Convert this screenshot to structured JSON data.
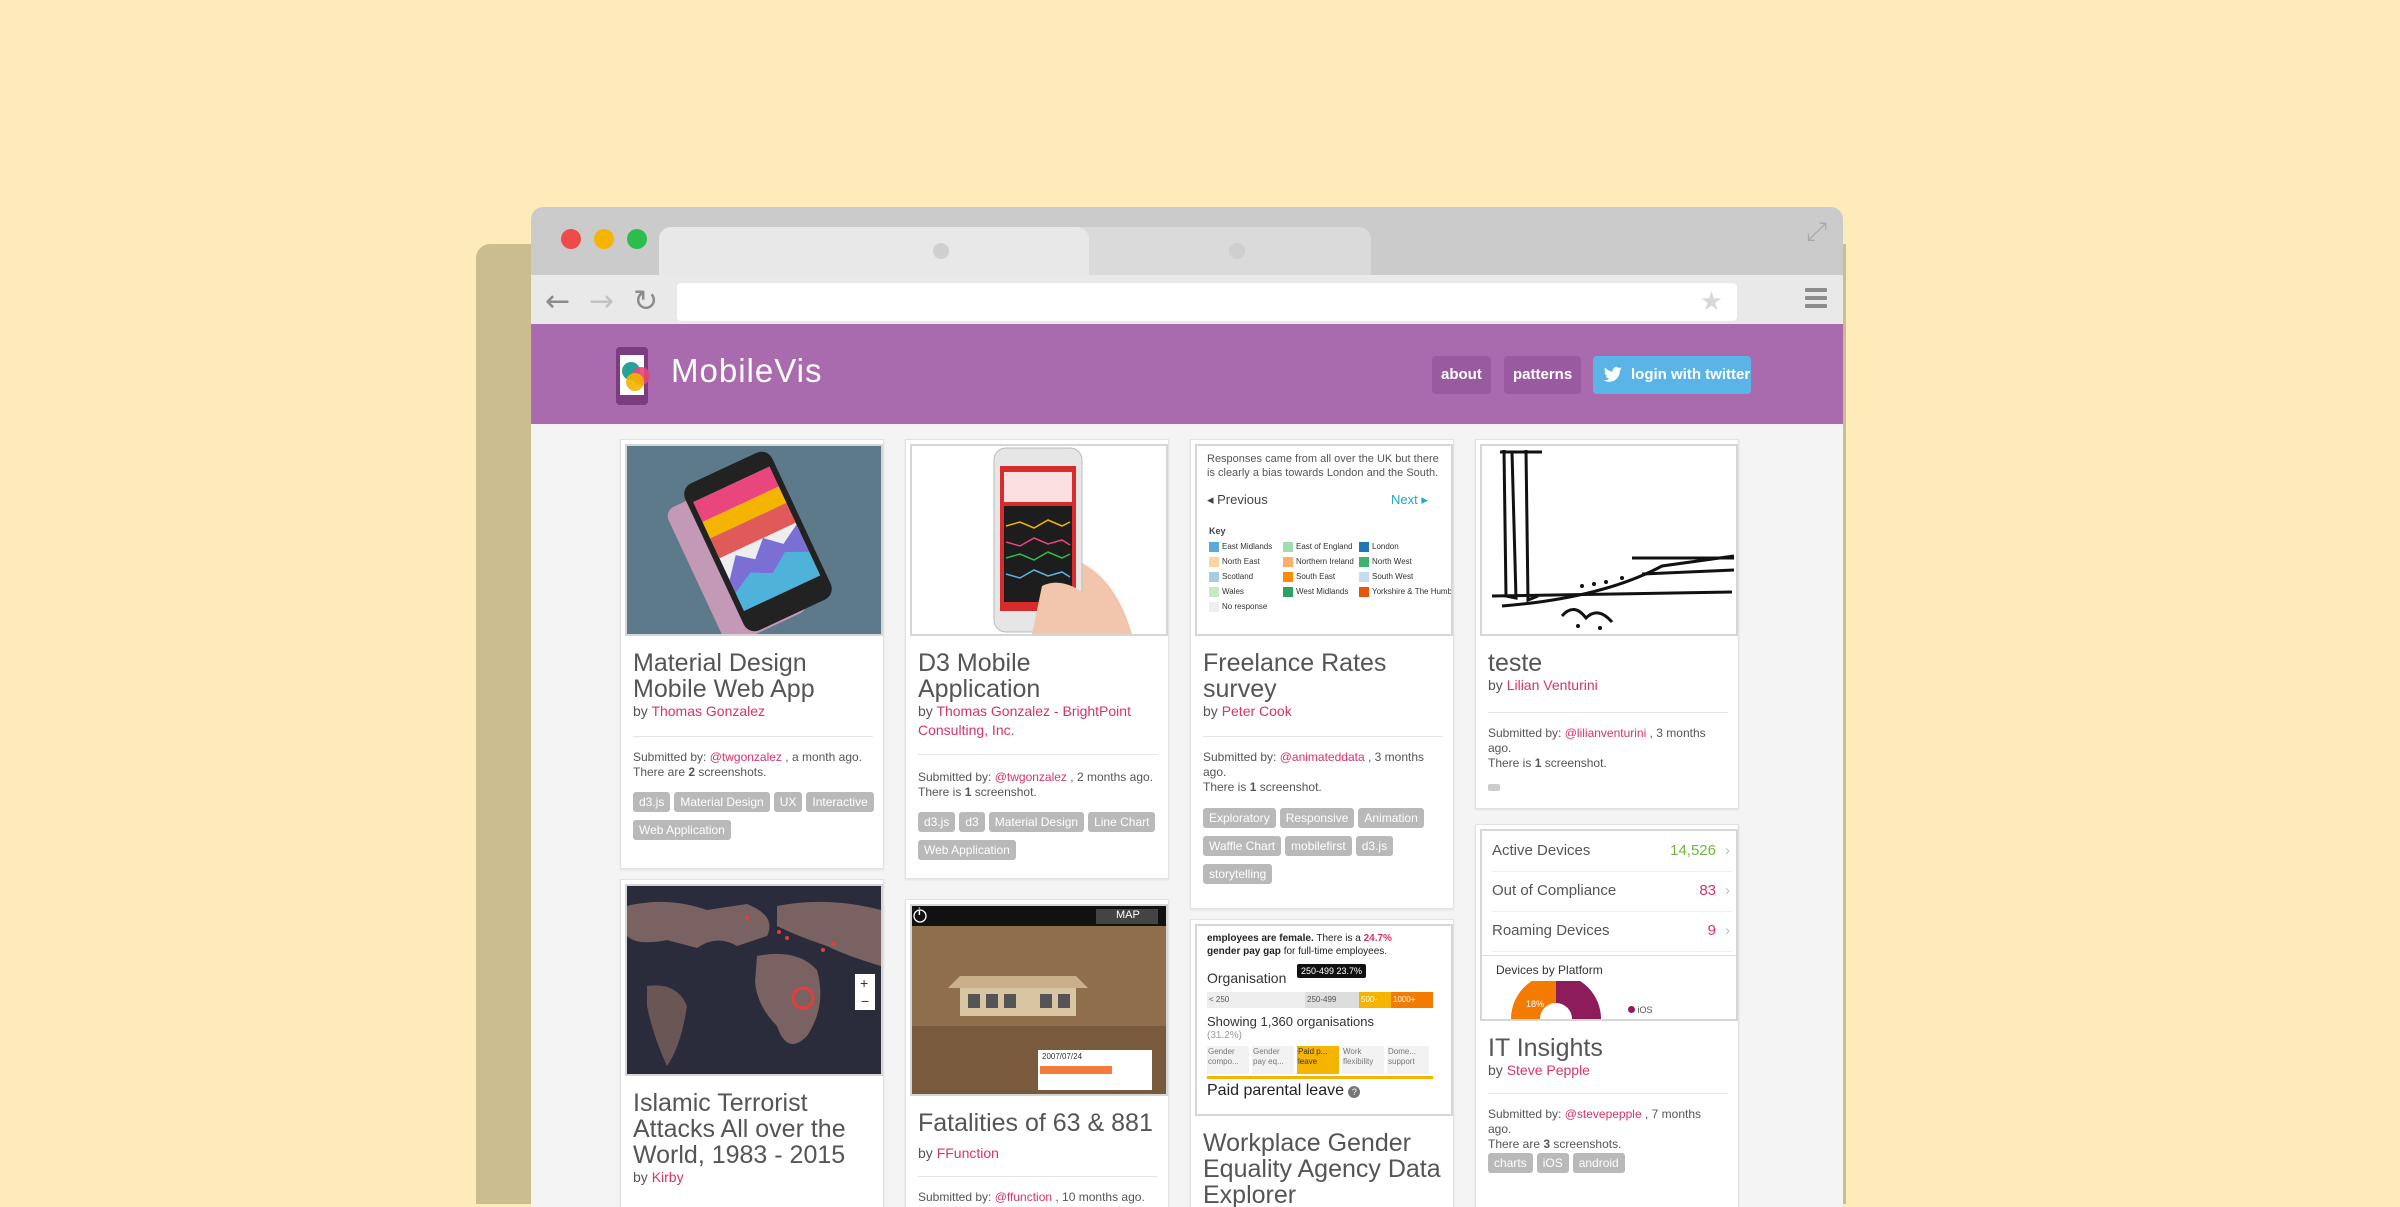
{
  "site": {
    "brand": "MobileVis",
    "nav": {
      "about": "about",
      "patterns": "patterns",
      "login": "login with twitter"
    }
  },
  "cards": [
    {
      "title": "Material Design Mobile Web App",
      "by_prefix": "by",
      "author": "Thomas Gonzalez",
      "submitted_prefix": "Submitted by:",
      "handle": "@twgonzalez",
      "submitted_suffix": ", a month ago.",
      "screens_prefix": "There are",
      "screens_count": "2",
      "screens_suffix": "screenshots.",
      "tags": [
        "d3.js",
        "Material Design",
        "UX",
        "Interactive",
        "Web Application"
      ]
    },
    {
      "title": "D3 Mobile Application",
      "by_prefix": "by",
      "author": "Thomas Gonzalez - BrightPoint Consulting, Inc.",
      "submitted_prefix": "Submitted by:",
      "handle": "@twgonzalez",
      "submitted_suffix": ", 2 months ago.",
      "screens_prefix": "There is",
      "screens_count": "1",
      "screens_suffix": "screenshot.",
      "tags": [
        "d3.js",
        "d3",
        "Material Design",
        "Line Chart",
        "Web Application"
      ]
    },
    {
      "title": "Freelance Rates survey",
      "by_prefix": "by",
      "author": "Peter Cook",
      "submitted_prefix": "Submitted by:",
      "handle": "@animateddata",
      "submitted_suffix": ", 3 months ago.",
      "screens_prefix": "There is",
      "screens_count": "1",
      "screens_suffix": "screenshot.",
      "tags": [
        "Exploratory",
        "Responsive",
        "Animation",
        "Waffle Chart",
        "mobilefirst",
        "d3.js",
        "storytelling"
      ]
    },
    {
      "title": "teste",
      "by_prefix": "by",
      "author": "Lilian Venturini",
      "submitted_prefix": "Submitted by:",
      "handle": "@lilianventurini",
      "submitted_suffix": ", 3 months ago.",
      "screens_prefix": "There is",
      "screens_count": "1",
      "screens_suffix": "screenshot."
    },
    {
      "title": "Islamic Terrorist Attacks All over the World, 1983 - 2015",
      "by_prefix": "by",
      "author": "Kirby"
    },
    {
      "title": "Fatalities of 63 & 881",
      "by_prefix": "by",
      "author": "FFunction",
      "submitted_prefix": "Submitted by:",
      "handle": "@ffunction",
      "submitted_suffix": ", 10 months ago."
    },
    {
      "title": "Workplace Gender Equality Agency Data Explorer"
    },
    {
      "title": "IT Insights",
      "by_prefix": "by",
      "author": "Steve Pepple",
      "submitted_prefix": "Submitted by:",
      "handle": "@stevepepple",
      "submitted_suffix": ", 7 months ago.",
      "screens_prefix": "There are",
      "screens_count": "3",
      "screens_suffix": "screenshots.",
      "tags": [
        "charts",
        "iOS",
        "android"
      ]
    }
  ],
  "thumb_freelance": {
    "text": "Responses came from all over the UK but there is clearly a bias towards London and the South.",
    "prev": "Previous",
    "next": "Next",
    "key": "Key",
    "legend": [
      {
        "label": "East Midlands",
        "color": "#5aa9d6"
      },
      {
        "label": "East of England",
        "color": "#9fdcb0"
      },
      {
        "label": "London",
        "color": "#1f78b4"
      },
      {
        "label": "North East",
        "color": "#fdd49e"
      },
      {
        "label": "Northern Ireland",
        "color": "#fdae6b"
      },
      {
        "label": "North West",
        "color": "#3cb371"
      },
      {
        "label": "Scotland",
        "color": "#a6cee3"
      },
      {
        "label": "South East",
        "color": "#ff8c00"
      },
      {
        "label": "South West",
        "color": "#c6dbef"
      },
      {
        "label": "Wales",
        "color": "#c7e9c0"
      },
      {
        "label": "West Midlands",
        "color": "#2ca25f"
      },
      {
        "label": "Yorkshire & The Humber",
        "color": "#e6550d"
      },
      {
        "label": "No response",
        "color": "#eeeeee"
      }
    ]
  },
  "thumb_fatalities": {
    "info": "i",
    "map": "MAP",
    "date": "2007/07/24"
  },
  "thumb_workplace": {
    "line1": "employees are female.",
    "line1b": "There is a",
    "pct": "24.7%",
    "line2": "gender pay gap",
    "line2b": "for full-time employees.",
    "org_label": "Organisation",
    "tooltip": "250-499 23.7%",
    "bands": [
      "< 250",
      "250-499",
      "500-",
      "1000+"
    ],
    "showing": "Showing 1,360 organisations",
    "showing_pct": "(31.2%)",
    "cols": [
      "Gender compo...",
      "Gender pay eq...",
      "Paid p... leave",
      "Work flexibility",
      "Dome... support"
    ],
    "footer": "Paid parental leave"
  },
  "it_list": [
    {
      "label": "Active Devices",
      "value": "14,526",
      "color": "#6fb53a"
    },
    {
      "label": "Out of Compliance",
      "value": "83",
      "color": "#d6336c"
    },
    {
      "label": "Roaming Devices",
      "value": "9",
      "color": "#d6336c"
    }
  ],
  "it_chart": {
    "title": "Devices by Platform",
    "pct": "18%",
    "legend": "iOS"
  },
  "colors": {
    "header": "#a96aae",
    "link": "#d6336c",
    "twitter": "#5ab4e8",
    "tag": "#b9b9b9"
  }
}
